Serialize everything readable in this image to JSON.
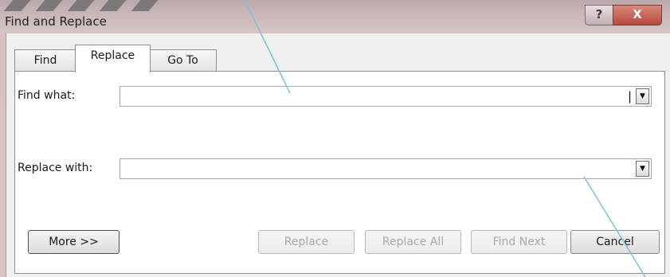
{
  "window": {
    "title": "Find and Replace",
    "help_glyph": "?",
    "close_glyph": "X"
  },
  "tabs": [
    {
      "label": "Find",
      "active": false
    },
    {
      "label": "Replace",
      "active": true
    },
    {
      "label": "Go To",
      "active": false
    }
  ],
  "find": {
    "label": "Find what:",
    "value": ""
  },
  "replace": {
    "label": "Replace with:",
    "value": ""
  },
  "buttons": {
    "more": "More >>",
    "replace": "Replace",
    "replace_all": "Replace All",
    "find_next": "Find Next",
    "cancel": "Cancel"
  },
  "colors": {
    "title_gradient": "#c7b3b4",
    "close_button": "#b8473a",
    "callout_line": "#7cc3d3"
  }
}
